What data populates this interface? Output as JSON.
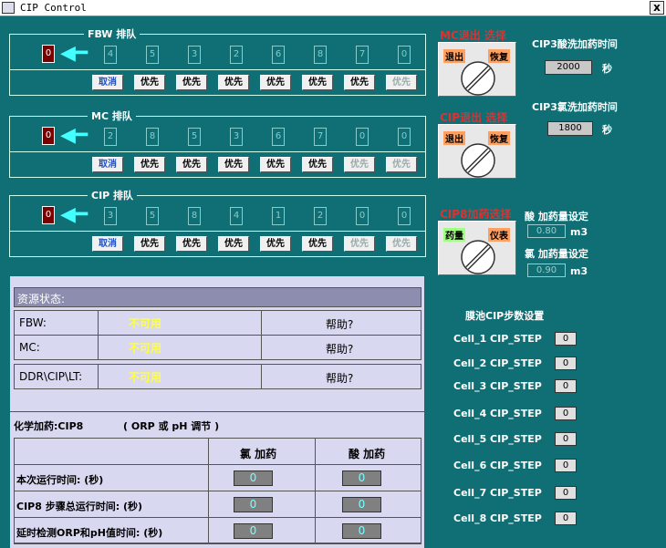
{
  "window": {
    "title": "CIP Control",
    "close": "x"
  },
  "queues": [
    {
      "title": "FBW 排队",
      "active": "0",
      "slots": [
        "4",
        "5",
        "3",
        "2",
        "6",
        "8",
        "7",
        "0"
      ],
      "buttons": [
        {
          "label": "取消",
          "state": "cancel"
        },
        {
          "label": "优先",
          "state": "normal"
        },
        {
          "label": "优先",
          "state": "normal"
        },
        {
          "label": "优先",
          "state": "normal"
        },
        {
          "label": "优先",
          "state": "normal"
        },
        {
          "label": "优先",
          "state": "normal"
        },
        {
          "label": "优先",
          "state": "normal"
        },
        {
          "label": "优先",
          "state": "disabled"
        }
      ]
    },
    {
      "title": "MC 排队",
      "active": "0",
      "slots": [
        "2",
        "8",
        "5",
        "3",
        "6",
        "7",
        "0",
        "0"
      ],
      "buttons": [
        {
          "label": "取消",
          "state": "cancel"
        },
        {
          "label": "优先",
          "state": "normal"
        },
        {
          "label": "优先",
          "state": "normal"
        },
        {
          "label": "优先",
          "state": "normal"
        },
        {
          "label": "优先",
          "state": "normal"
        },
        {
          "label": "优先",
          "state": "normal"
        },
        {
          "label": "优先",
          "state": "disabled"
        },
        {
          "label": "优先",
          "state": "disabled"
        }
      ]
    },
    {
      "title": "CIP 排队",
      "active": "0",
      "slots": [
        "3",
        "5",
        "8",
        "4",
        "1",
        "2",
        "0",
        "0"
      ],
      "buttons": [
        {
          "label": "取消",
          "state": "cancel"
        },
        {
          "label": "优先",
          "state": "normal"
        },
        {
          "label": "优先",
          "state": "normal"
        },
        {
          "label": "优先",
          "state": "normal"
        },
        {
          "label": "优先",
          "state": "normal"
        },
        {
          "label": "优先",
          "state": "normal"
        },
        {
          "label": "优先",
          "state": "disabled"
        },
        {
          "label": "优先",
          "state": "disabled"
        }
      ]
    }
  ],
  "selectors": [
    {
      "title": "MC退出 选择",
      "left": "退出",
      "right": "恢复"
    },
    {
      "title": "CIP退出 选择",
      "left": "退出",
      "right": "恢复"
    },
    {
      "title": "CIP8加药选择",
      "left": "药量",
      "right": "仪表"
    }
  ],
  "dosing": {
    "acid_time_label": "CIP3酸洗加药时间",
    "acid_time": "2000",
    "acid_unit": "秒",
    "cl_time_label": "CIP3氯洗加药时间",
    "cl_time": "1800",
    "cl_unit": "秒",
    "acid_amount_label": "酸 加药量设定",
    "acid_amount": "0.80",
    "acid_amount_unit": "m3",
    "cl_amount_label": "氯 加药量设定",
    "cl_amount": "0.90",
    "cl_amount_unit": "m3"
  },
  "resources": {
    "header": "资源状态:",
    "rows": [
      {
        "name": "FBW:",
        "status": "不可用",
        "help": "帮助?"
      },
      {
        "name": "MC:",
        "status": "不可用",
        "help": "帮助?"
      },
      {
        "name": "DDR\\CIP\\LT:",
        "status": "不可用",
        "help": "帮助?"
      }
    ]
  },
  "chem": {
    "title": "化学加药:CIP8",
    "subtitle": "( ORP 或 pH 调节 )",
    "col_cl": "氯 加药",
    "col_acid": "酸 加药",
    "rows": [
      {
        "label": "本次运行时间: (秒)",
        "cl": "0",
        "acid": "0"
      },
      {
        "label": "CIP8 步骤总运行时间: (秒)",
        "cl": "0",
        "acid": "0"
      },
      {
        "label": "延时检测ORP和pH值时间: (秒)",
        "cl": "0",
        "acid": "0"
      }
    ]
  },
  "steps": {
    "title": "膜池CIP步数设置",
    "items": [
      {
        "label": "Cell_1 CIP_STEP",
        "value": "0"
      },
      {
        "label": "Cell_2 CIP_STEP",
        "value": "0"
      },
      {
        "label": "Cell_3 CIP_STEP",
        "value": "0"
      },
      {
        "label": "Cell_4 CIP_STEP",
        "value": "0"
      },
      {
        "label": "Cell_5 CIP_STEP",
        "value": "0"
      },
      {
        "label": "Cell_6 CIP_STEP",
        "value": "0"
      },
      {
        "label": "Cell_7 CIP_STEP",
        "value": "0"
      },
      {
        "label": "Cell_8 CIP_STEP",
        "value": "0"
      }
    ]
  }
}
